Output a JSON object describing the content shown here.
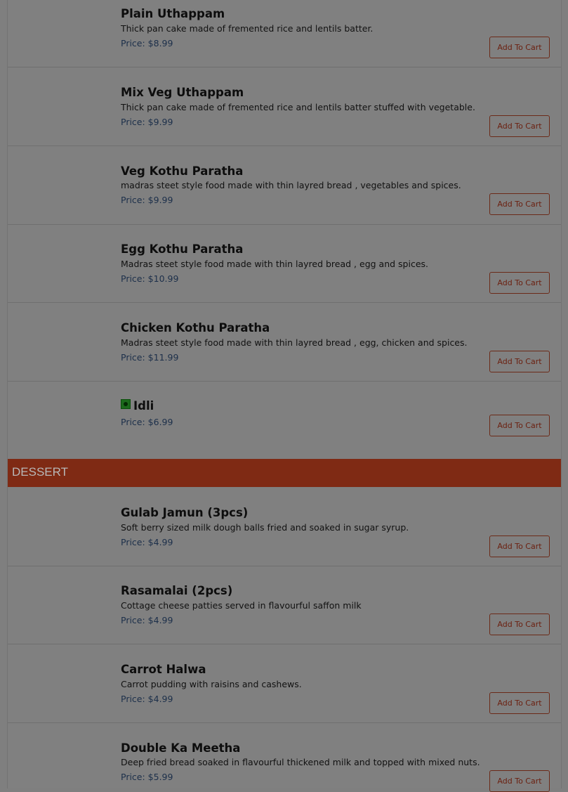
{
  "items_before": [
    {
      "title": "Plain Uthappam",
      "desc": "Thick pan cake made of fremented rice and lentils batter.",
      "price": "Price: $8.99",
      "button": "Add To Cart"
    },
    {
      "title": "Mix Veg Uthappam",
      "desc": "Thick pan cake made of fremented rice and lentils batter stuffed with vegetable.",
      "price": "Price: $9.99",
      "button": "Add To Cart"
    },
    {
      "title": "Veg Kothu Paratha",
      "desc": "madras steet style food made with thin layred bread , vegetables and spices.",
      "price": "Price: $9.99",
      "button": "Add To Cart"
    },
    {
      "title": "Egg Kothu Paratha",
      "desc": "Madras steet style food made with thin layred bread , egg and spices.",
      "price": "Price: $10.99",
      "button": "Add To Cart"
    },
    {
      "title": "Chicken Kothu Paratha",
      "desc": "Madras steet style food made with thin layred bread , egg, chicken and spices.",
      "price": "Price: $11.99",
      "button": "Add To Cart"
    },
    {
      "title": "Idli",
      "price": "Price: $6.99",
      "button": "Add To Cart",
      "icon": "veg-indicator-icon"
    }
  ],
  "section": {
    "label": "DESSERT"
  },
  "items_after": [
    {
      "title": "Gulab Jamun (3pcs)",
      "desc": "Soft berry sized milk dough balls fried and soaked in sugar syrup.",
      "price": "Price: $4.99",
      "button": "Add To Cart"
    },
    {
      "title": "Rasamalai (2pcs)",
      "desc": "Cottage cheese patties served in flavourful saffon milk",
      "price": "Price: $4.99",
      "button": "Add To Cart"
    },
    {
      "title": "Carrot Halwa",
      "desc": "Carrot pudding with raisins and cashews.",
      "price": "Price: $4.99",
      "button": "Add To Cart"
    },
    {
      "title": "Double Ka Meetha",
      "desc": "Deep fried bread soaked in flavourful thickened milk and topped with mixed nuts.",
      "price": "Price: $5.99",
      "button": "Add To Cart"
    }
  ],
  "colors": {
    "section_header_bg": "#7f2a14",
    "overlay": "#808080",
    "button_border": "#6b2a18"
  }
}
